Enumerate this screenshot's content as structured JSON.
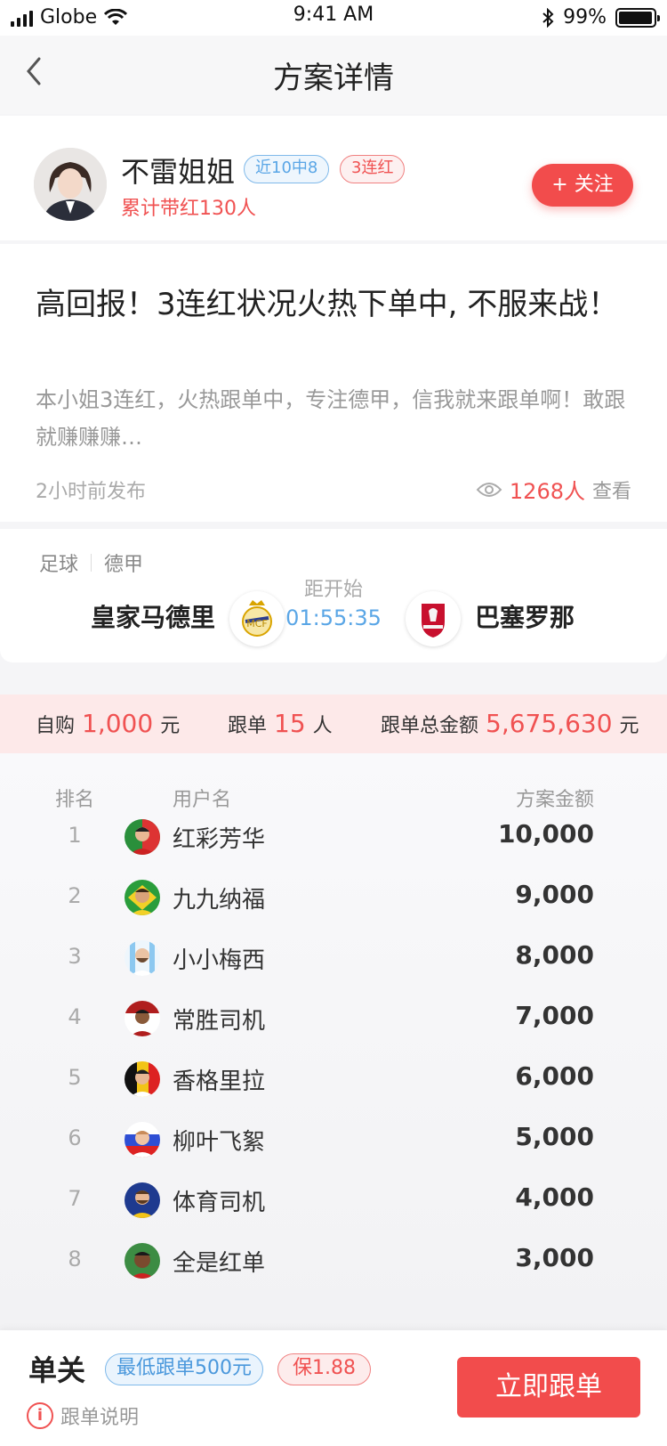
{
  "status": {
    "carrier": "Globe",
    "time": "9:41 AM",
    "battery": "99%"
  },
  "nav": {
    "title": "方案详情"
  },
  "author": {
    "name": "不雷姐姐",
    "tag_recent": "近10中8",
    "tag_streak": "3连红",
    "sub": "累计带红130人",
    "follow_label": "+ 关注"
  },
  "article": {
    "title": "高回报！3连红状况火热下单中, 不服来战！",
    "desc": "本小姐3连红，火热跟单中，专注德甲，信我就来跟单啊！敢跟就赚赚赚…",
    "time": "2小时前发布",
    "views": "1268人",
    "views_suffix": "查看"
  },
  "match": {
    "sport": "足球",
    "league": "德甲",
    "home": "皇家马德里",
    "away": "巴塞罗那",
    "countdown_label": "距开始",
    "countdown": "01:55:35"
  },
  "stats": {
    "self_label": "自购",
    "self_val": "1,000",
    "self_unit": "元",
    "follow_label": "跟单",
    "follow_val": "15",
    "follow_unit": "人",
    "total_label": "跟单总金额",
    "total_val": "5,675,630",
    "total_unit": "元"
  },
  "rank": {
    "headers": {
      "rank": "排名",
      "user": "用户名",
      "amount": "方案金额"
    },
    "rows": [
      {
        "no": "1",
        "name": "红彩芳华",
        "amount": "10,000",
        "color": "#d33"
      },
      {
        "no": "2",
        "name": "九九纳福",
        "amount": "9,000",
        "color": "#2a9d3b"
      },
      {
        "no": "3",
        "name": "小小梅西",
        "amount": "8,000",
        "color": "#7ec1ef"
      },
      {
        "no": "4",
        "name": "常胜司机",
        "amount": "7,000",
        "color": "#b01e1e"
      },
      {
        "no": "5",
        "name": "香格里拉",
        "amount": "6,000",
        "color": "#e5b800"
      },
      {
        "no": "6",
        "name": "柳叶飞絮",
        "amount": "5,000",
        "color": "#2f4fd4"
      },
      {
        "no": "7",
        "name": "体育司机",
        "amount": "4,000",
        "color": "#f2c417"
      },
      {
        "no": "8",
        "name": "全是红单",
        "amount": "3,000",
        "color": "#3c8c43"
      }
    ]
  },
  "bottom": {
    "type": "单关",
    "min_label": "最低跟单500元",
    "guarantee": "保1.88",
    "help": "跟单说明",
    "cta": "立即跟单"
  }
}
